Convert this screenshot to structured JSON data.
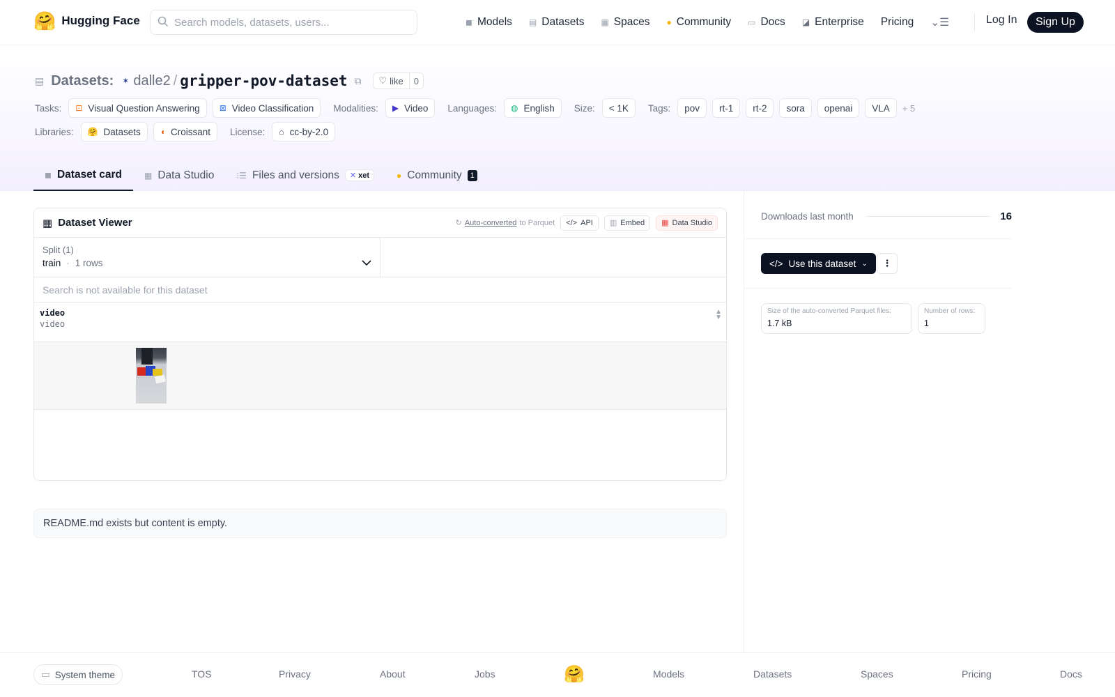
{
  "nav": {
    "brand": "Hugging Face",
    "search_placeholder": "Search models, datasets, users...",
    "links": [
      "Models",
      "Datasets",
      "Spaces",
      "Community",
      "Docs",
      "Enterprise",
      "Pricing"
    ],
    "login": "Log In",
    "signup": "Sign Up"
  },
  "repo": {
    "type_label": "Datasets:",
    "user": "dalle2",
    "separator": "/",
    "name": "gripper-pov-dataset",
    "like_label": "like",
    "like_count": "0"
  },
  "meta": {
    "tasks_label": "Tasks:",
    "tasks": [
      "Visual Question Answering",
      "Video Classification"
    ],
    "modalities_label": "Modalities:",
    "modalities": [
      "Video"
    ],
    "languages_label": "Languages:",
    "languages": [
      "English"
    ],
    "size_label": "Size:",
    "size": "< 1K",
    "tags_label": "Tags:",
    "tags": [
      "pov",
      "rt-1",
      "rt-2",
      "sora",
      "openai",
      "VLA"
    ],
    "tags_more": "+ 5",
    "libraries_label": "Libraries:",
    "libraries": [
      "Datasets",
      "Croissant"
    ],
    "license_label": "License:",
    "license": "cc-by-2.0"
  },
  "tabs": {
    "dataset_card": "Dataset card",
    "data_studio": "Data Studio",
    "files": "Files and versions",
    "xet": "xet",
    "community": "Community",
    "community_count": "1"
  },
  "viewer": {
    "title": "Dataset Viewer",
    "autoconverted": "Auto-converted",
    "to_parquet": "to Parquet",
    "api": "API",
    "embed": "Embed",
    "data_studio": "Data Studio",
    "split_label": "Split (1)",
    "split_value": "train",
    "split_dot": "·",
    "split_rows": "1 rows",
    "search_na": "Search is not available for this dataset",
    "column_name": "video",
    "column_type": "video"
  },
  "readme": "README.md exists but content is empty.",
  "sidebar": {
    "downloads_label": "Downloads last month",
    "downloads_value": "16",
    "use_dataset": "Use this dataset",
    "parquet_size_label": "Size of the auto-converted Parquet files:",
    "parquet_size": "1.7 kB",
    "rows_label": "Number of rows:",
    "rows": "1"
  },
  "footer": {
    "theme": "System theme",
    "links": [
      "TOS",
      "Privacy",
      "About",
      "Jobs",
      "Models",
      "Datasets",
      "Spaces",
      "Pricing",
      "Docs"
    ]
  }
}
